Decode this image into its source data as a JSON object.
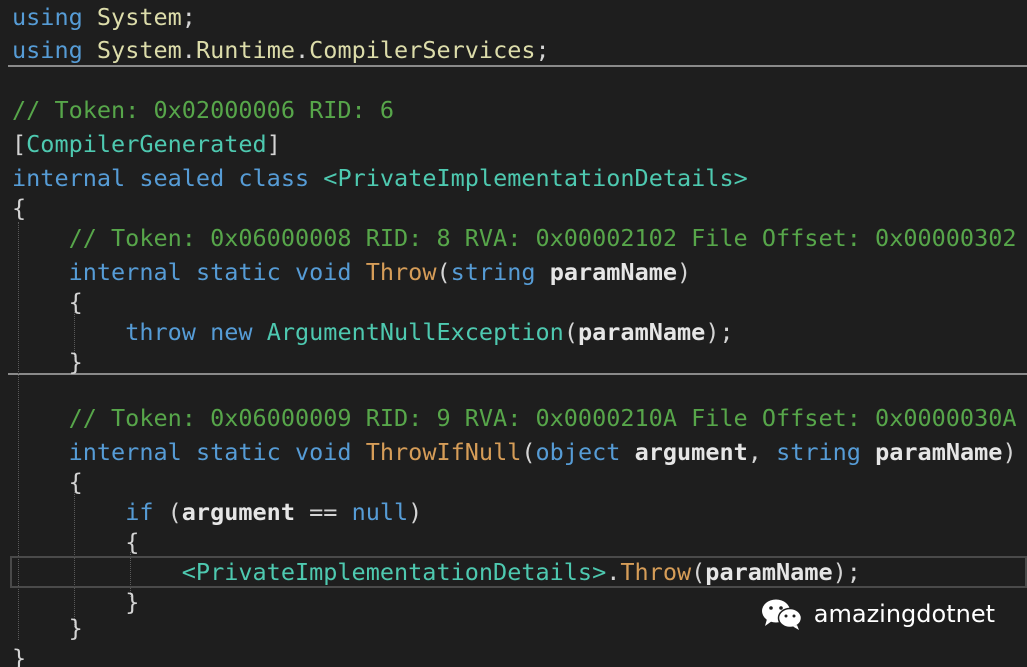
{
  "lines": [
    [
      {
        "t": "using",
        "c": "kw"
      },
      {
        "t": " ",
        "c": "pl"
      },
      {
        "t": "System",
        "c": "fn"
      },
      {
        "t": ";",
        "c": "pl"
      }
    ],
    [
      {
        "t": "using",
        "c": "kw"
      },
      {
        "t": " ",
        "c": "pl"
      },
      {
        "t": "System",
        "c": "fn"
      },
      {
        "t": ".",
        "c": "pl"
      },
      {
        "t": "Runtime",
        "c": "fn"
      },
      {
        "t": ".",
        "c": "pl"
      },
      {
        "t": "CompilerServices",
        "c": "fn"
      },
      {
        "t": ";",
        "c": "pl"
      }
    ],
    [],
    [
      {
        "t": "// Token: 0x02000006 RID: 6",
        "c": "cm"
      }
    ],
    [
      {
        "t": "[",
        "c": "pl"
      },
      {
        "t": "CompilerGenerated",
        "c": "ty"
      },
      {
        "t": "]",
        "c": "pl"
      }
    ],
    [
      {
        "t": "internal",
        "c": "kw"
      },
      {
        "t": " ",
        "c": "pl"
      },
      {
        "t": "sealed",
        "c": "kw"
      },
      {
        "t": " ",
        "c": "pl"
      },
      {
        "t": "class",
        "c": "kw"
      },
      {
        "t": " ",
        "c": "pl"
      },
      {
        "t": "<PrivateImplementationDetails>",
        "c": "ty"
      }
    ],
    [
      {
        "t": "{",
        "c": "pl"
      }
    ],
    [
      {
        "t": "    ",
        "c": "pl"
      },
      {
        "t": "// Token: 0x06000008 RID: 8 RVA: 0x00002102 File Offset: 0x00000302",
        "c": "cm"
      }
    ],
    [
      {
        "t": "    ",
        "c": "pl"
      },
      {
        "t": "internal",
        "c": "kw"
      },
      {
        "t": " ",
        "c": "pl"
      },
      {
        "t": "static",
        "c": "kw"
      },
      {
        "t": " ",
        "c": "pl"
      },
      {
        "t": "void",
        "c": "kw"
      },
      {
        "t": " ",
        "c": "pl"
      },
      {
        "t": "Throw",
        "c": "me"
      },
      {
        "t": "(",
        "c": "pl"
      },
      {
        "t": "string",
        "c": "kw"
      },
      {
        "t": " ",
        "c": "pl"
      },
      {
        "t": "paramName",
        "c": "pr"
      },
      {
        "t": ")",
        "c": "pl"
      }
    ],
    [
      {
        "t": "    ",
        "c": "pl"
      },
      {
        "t": "{",
        "c": "pl"
      }
    ],
    [
      {
        "t": "        ",
        "c": "pl"
      },
      {
        "t": "throw",
        "c": "kw"
      },
      {
        "t": " ",
        "c": "pl"
      },
      {
        "t": "new",
        "c": "kw"
      },
      {
        "t": " ",
        "c": "pl"
      },
      {
        "t": "ArgumentNullException",
        "c": "ty"
      },
      {
        "t": "(",
        "c": "pl"
      },
      {
        "t": "paramName",
        "c": "pr"
      },
      {
        "t": ");",
        "c": "pl"
      }
    ],
    [
      {
        "t": "    ",
        "c": "pl"
      },
      {
        "t": "}",
        "c": "pl"
      }
    ],
    [],
    [
      {
        "t": "    ",
        "c": "pl"
      },
      {
        "t": "// Token: 0x06000009 RID: 9 RVA: 0x0000210A File Offset: 0x0000030A",
        "c": "cm"
      }
    ],
    [
      {
        "t": "    ",
        "c": "pl"
      },
      {
        "t": "internal",
        "c": "kw"
      },
      {
        "t": " ",
        "c": "pl"
      },
      {
        "t": "static",
        "c": "kw"
      },
      {
        "t": " ",
        "c": "pl"
      },
      {
        "t": "void",
        "c": "kw"
      },
      {
        "t": " ",
        "c": "pl"
      },
      {
        "t": "ThrowIfNull",
        "c": "me"
      },
      {
        "t": "(",
        "c": "pl"
      },
      {
        "t": "object",
        "c": "kw"
      },
      {
        "t": " ",
        "c": "pl"
      },
      {
        "t": "argument",
        "c": "pr"
      },
      {
        "t": ", ",
        "c": "pl"
      },
      {
        "t": "string",
        "c": "kw"
      },
      {
        "t": " ",
        "c": "pl"
      },
      {
        "t": "paramName",
        "c": "pr"
      },
      {
        "t": ")",
        "c": "pl"
      }
    ],
    [
      {
        "t": "    ",
        "c": "pl"
      },
      {
        "t": "{",
        "c": "pl"
      }
    ],
    [
      {
        "t": "        ",
        "c": "pl"
      },
      {
        "t": "if",
        "c": "kw"
      },
      {
        "t": " (",
        "c": "pl"
      },
      {
        "t": "argument",
        "c": "pr"
      },
      {
        "t": " == ",
        "c": "pl"
      },
      {
        "t": "null",
        "c": "kw"
      },
      {
        "t": ")",
        "c": "pl"
      }
    ],
    [
      {
        "t": "        ",
        "c": "pl"
      },
      {
        "t": "{",
        "c": "pl"
      }
    ],
    [
      {
        "t": "            ",
        "c": "pl"
      },
      {
        "t": "<PrivateImplementationDetails>",
        "c": "ty"
      },
      {
        "t": ".",
        "c": "pl"
      },
      {
        "t": "Throw",
        "c": "me"
      },
      {
        "t": "(",
        "c": "pl"
      },
      {
        "t": "paramName",
        "c": "pr"
      },
      {
        "t": ");",
        "c": "pl"
      }
    ],
    [
      {
        "t": "        ",
        "c": "pl"
      },
      {
        "t": "}",
        "c": "pl"
      }
    ],
    [
      {
        "t": "    ",
        "c": "pl"
      },
      {
        "t": "}",
        "c": "pl"
      }
    ],
    [
      {
        "t": "}",
        "c": "pl"
      }
    ]
  ],
  "watermark": {
    "text": "amazingdotnet",
    "icon": "wechat-icon"
  },
  "colors": {
    "background": "#1e1e1e",
    "keyword": "#569cd6",
    "type": "#4ec9b0",
    "namespace": "#dcdcaa",
    "method": "#d69d58",
    "comment": "#57a64a",
    "parameter": "#e6e6e6",
    "plain": "#d4d4d4"
  }
}
